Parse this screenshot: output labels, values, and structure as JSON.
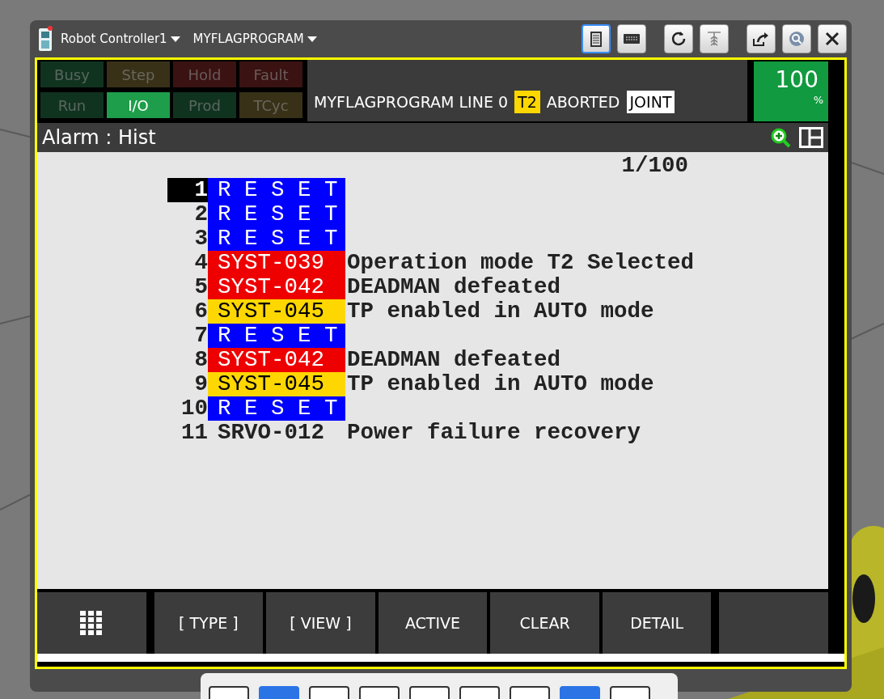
{
  "title_bar": {
    "controller": "Robot Controller1",
    "program": "MYFLAGPROGRAM"
  },
  "toolbar": [
    {
      "kind": "pendant",
      "selected": true
    },
    {
      "kind": "keyboard",
      "selected": false
    },
    {
      "kind": "refresh",
      "selected": false
    },
    {
      "kind": "jog",
      "selected": false
    },
    {
      "kind": "export",
      "selected": false
    },
    {
      "kind": "help",
      "selected": false
    },
    {
      "kind": "close",
      "selected": false
    }
  ],
  "lamps": [
    {
      "label": "Busy",
      "on": false,
      "color": "#10331f"
    },
    {
      "label": "Step",
      "on": false,
      "color": "#383118"
    },
    {
      "label": "Hold",
      "on": false,
      "color": "#3a1212"
    },
    {
      "label": "Fault",
      "on": false,
      "color": "#3a1212"
    },
    {
      "label": "Run",
      "on": false,
      "color": "#10331f"
    },
    {
      "label": "I/O",
      "on": true,
      "color": "#1e9e4a"
    },
    {
      "label": "Prod",
      "on": false,
      "color": "#10331f"
    },
    {
      "label": "TCyc",
      "on": false,
      "color": "#383118"
    }
  ],
  "status_line": {
    "program": "MYFLAGPROGRAM LINE 0",
    "mode": "T2",
    "state": "ABORTED",
    "coord": "JOINT"
  },
  "override": {
    "value": "100",
    "unit": "%"
  },
  "screen_title": "Alarm : Hist",
  "counter": "1/100",
  "alarms": [
    {
      "number": "1",
      "code": "R E S E T",
      "kind": "reset",
      "selected": true
    },
    {
      "number": "2",
      "code": "R E S E T",
      "kind": "reset",
      "selected": false
    },
    {
      "number": "3",
      "code": "R E S E T",
      "kind": "reset",
      "selected": false
    },
    {
      "number": "4",
      "code": "SYST-039",
      "message": "Operation mode T2 Selected",
      "kind": "error",
      "selected": false
    },
    {
      "number": "5",
      "code": "SYST-042",
      "message": "DEADMAN defeated",
      "kind": "error",
      "selected": false
    },
    {
      "number": "6",
      "code": "SYST-045",
      "message": "TP enabled in AUTO mode",
      "kind": "warning",
      "selected": false
    },
    {
      "number": "7",
      "code": "R E S E T",
      "kind": "reset",
      "selected": false
    },
    {
      "number": "8",
      "code": "SYST-042",
      "message": "DEADMAN defeated",
      "kind": "error",
      "selected": false
    },
    {
      "number": "9",
      "code": "SYST-045",
      "message": "TP enabled in AUTO mode",
      "kind": "warning",
      "selected": false
    },
    {
      "number": "10",
      "code": "R E S E T",
      "kind": "reset",
      "selected": false
    },
    {
      "number": "11",
      "code": "SRVO-012",
      "message": "Power failure recovery",
      "kind": "plain",
      "selected": false
    }
  ],
  "function_keys": [
    {
      "kind": "menu"
    },
    {
      "kind": "text",
      "label": "[ TYPE ]"
    },
    {
      "kind": "text",
      "label": "[ VIEW ]"
    },
    {
      "kind": "text",
      "label": "ACTIVE"
    },
    {
      "kind": "text",
      "label": "CLEAR"
    },
    {
      "kind": "text",
      "label": "DETAIL"
    },
    {
      "kind": "blank"
    }
  ],
  "keypad": [
    {
      "kind": "plain"
    },
    {
      "kind": "shift"
    },
    {
      "kind": "plain"
    },
    {
      "kind": "plain"
    },
    {
      "kind": "plain"
    },
    {
      "kind": "plain"
    },
    {
      "kind": "plain"
    },
    {
      "kind": "shift"
    },
    {
      "kind": "plain"
    }
  ]
}
